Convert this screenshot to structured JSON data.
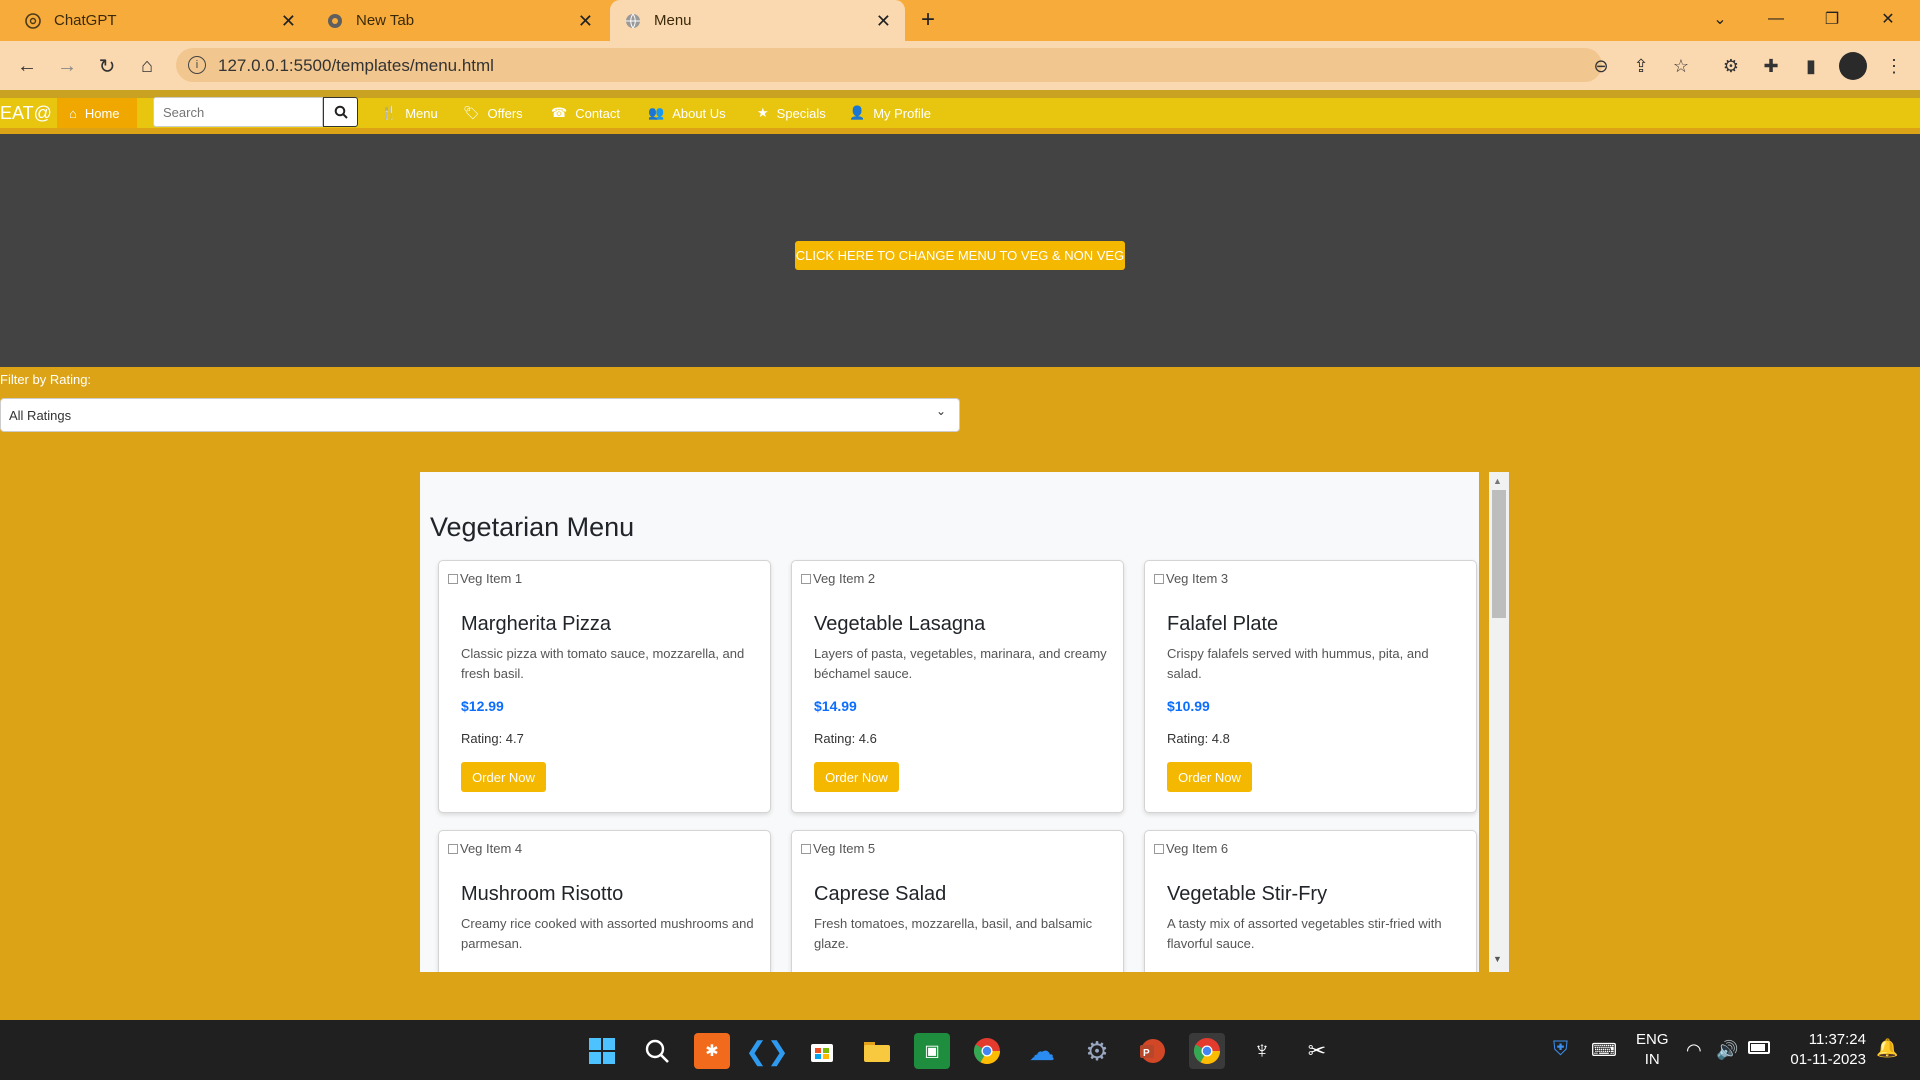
{
  "browser": {
    "tabs": [
      {
        "title": "ChatGPT",
        "icon": "chatgpt-icon"
      },
      {
        "title": "New Tab",
        "icon": "chrome-icon"
      },
      {
        "title": "Menu",
        "icon": "globe-icon"
      }
    ],
    "url": "127.0.0.1:5500/templates/menu.html"
  },
  "site": {
    "brand": "EAT@",
    "nav": {
      "home": "Home",
      "search_placeholder": "Search",
      "menu": "Menu",
      "offers": "Offers",
      "contact": "Contact",
      "about": "About Us",
      "specials": "Specials",
      "profile": "My Profile"
    },
    "hero_button": "CLICK HERE TO CHANGE MENU TO VEG & NON VEG",
    "filter": {
      "label": "Filter by Rating:",
      "selected": "All Ratings"
    },
    "menu_title": "Vegetarian Menu",
    "items": [
      {
        "img_alt": "Veg Item 1",
        "name": "Margherita Pizza",
        "desc": "Classic pizza with tomato sauce, mozzarella, and fresh basil.",
        "price": "$12.99",
        "rating": "Rating: 4.7",
        "order": "Order Now"
      },
      {
        "img_alt": "Veg Item 2",
        "name": "Vegetable Lasagna",
        "desc": "Layers of pasta, vegetables, marinara, and creamy béchamel sauce.",
        "price": "$14.99",
        "rating": "Rating: 4.6",
        "order": "Order Now"
      },
      {
        "img_alt": "Veg Item 3",
        "name": "Falafel Plate",
        "desc": "Crispy falafels served with hummus, pita, and salad.",
        "price": "$10.99",
        "rating": "Rating: 4.8",
        "order": "Order Now"
      },
      {
        "img_alt": "Veg Item 4",
        "name": "Mushroom Risotto",
        "desc": "Creamy rice cooked with assorted mushrooms and parmesan."
      },
      {
        "img_alt": "Veg Item 5",
        "name": "Caprese Salad",
        "desc": "Fresh tomatoes, mozzarella, basil, and balsamic glaze."
      },
      {
        "img_alt": "Veg Item 6",
        "name": "Vegetable Stir-Fry",
        "desc": "A tasty mix of assorted vegetables stir-fried with flavorful sauce."
      }
    ]
  },
  "taskbar": {
    "lang": "ENG",
    "region": "IN",
    "time": "11:37:24",
    "date": "01-11-2023"
  },
  "colors": {
    "tab_strip": "#f7ab3a",
    "page_bg": "#dca316",
    "navbar": "#e8c60f",
    "accent_button": "#f5b800",
    "hero": "#434343",
    "price": "#0d6efd"
  }
}
